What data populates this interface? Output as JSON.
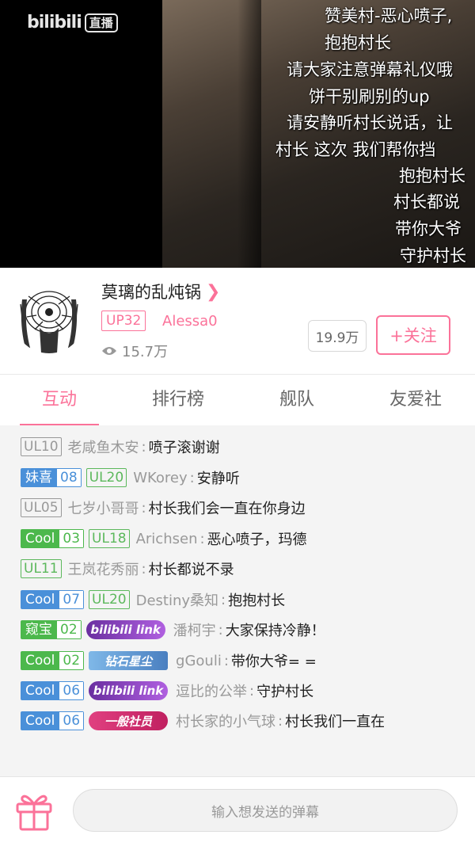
{
  "player": {
    "logo_text": "bilibili",
    "logo_badge": "直播",
    "danmaku": [
      {
        "text": "赞美村-恶心喷子,"
      },
      {
        "text": "抱抱村长"
      },
      {
        "text": "请大家注意弹幕礼仪哦"
      },
      {
        "text": "饼干别刷别的up"
      },
      {
        "text": "请安静听村长说话，让"
      },
      {
        "text": "村长 这次 我们帮你挡"
      },
      {
        "text": "抱抱村长"
      },
      {
        "text": "村长都说"
      },
      {
        "text": "带你大爷"
      },
      {
        "text": "守护村长"
      }
    ]
  },
  "room": {
    "title": "莫璃的乱炖锅",
    "up_level": "UP32",
    "up_name": "Alessa0",
    "views": "15.7万",
    "fans": "19.9万",
    "follow_label": "+关注"
  },
  "tabs": [
    {
      "label": "互动"
    },
    {
      "label": "排行榜"
    },
    {
      "label": "舰队"
    },
    {
      "label": "友爱社"
    }
  ],
  "chat": [
    {
      "ul": "UL10",
      "user": "老咸鱼木安",
      "msg": "喷子滚谢谢"
    },
    {
      "medal": "妹喜",
      "medal_lvl": "08",
      "ul": "UL20",
      "user": "WKorey",
      "msg": "安静听"
    },
    {
      "ul": "UL05",
      "user": "七岁小哥哥",
      "msg": "村长我们会一直在你身边"
    },
    {
      "medal": "Cool",
      "medal_lvl": "03",
      "ul": "UL18",
      "user": "Arichsen",
      "msg": "恶心喷子，玛德"
    },
    {
      "ul": "UL11",
      "user": "王岚花秀丽",
      "msg": "村长都说不录"
    },
    {
      "medal": "Cool",
      "medal_lvl": "07",
      "ul": "UL20",
      "user": "Destiny桑知",
      "msg": "抱抱村长"
    },
    {
      "medal": "窥宝",
      "medal_lvl": "02",
      "title": "bilibili link",
      "user": "潘柯宇",
      "msg": "大家保持冷静！"
    },
    {
      "medal": "Cool",
      "medal_lvl": "02",
      "title": "钻石星尘",
      "user": "gGouli",
      "msg": "带你大爷= ="
    },
    {
      "medal": "Cool",
      "medal_lvl": "06",
      "title": "bilibili link",
      "user": "逗比的公举",
      "msg": "守护村长"
    },
    {
      "medal": "Cool",
      "medal_lvl": "06",
      "title": "一般社员",
      "user": "村长家的小气球",
      "msg": "村长我们一直在"
    }
  ],
  "input": {
    "placeholder": "输入想发送的弹幕"
  },
  "colors": {
    "accent": "#fb7299",
    "medal_blue": "#4a90d9",
    "medal_green": "#4cb84c",
    "ul_gray": "#999999",
    "ul_green": "#5cb85c",
    "title_purple": "#8a3fb8"
  }
}
